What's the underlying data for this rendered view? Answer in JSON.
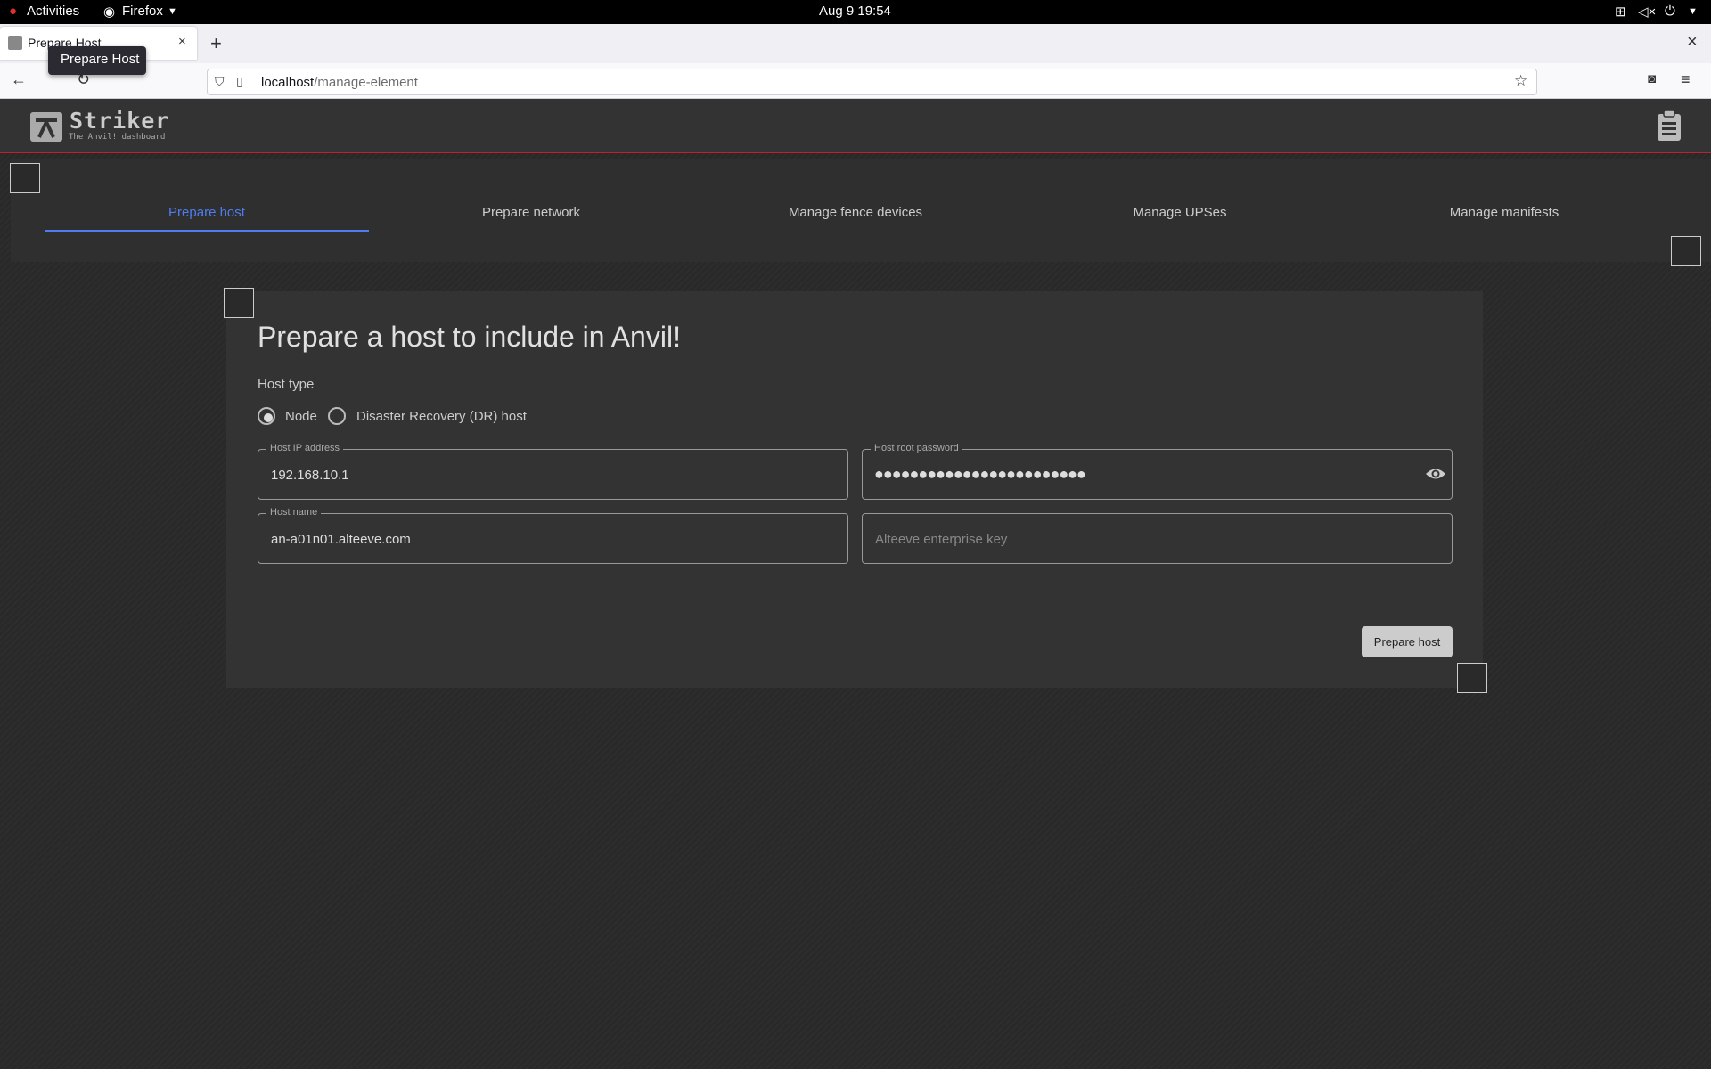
{
  "system_bar": {
    "activities": "Activities",
    "app": "Firefox",
    "clock": "Aug 9  19:54"
  },
  "browser": {
    "tab_title": "Prepare Host",
    "tooltip": "Prepare Host",
    "url_host": "localhost",
    "url_path": "/manage-element"
  },
  "app": {
    "name": "Striker",
    "subtitle": "The Anvil! dashboard"
  },
  "tabs": [
    {
      "label": "Prepare host",
      "active": true
    },
    {
      "label": "Prepare network",
      "active": false
    },
    {
      "label": "Manage fence devices",
      "active": false
    },
    {
      "label": "Manage UPSes",
      "active": false
    },
    {
      "label": "Manage manifests",
      "active": false
    }
  ],
  "form": {
    "title": "Prepare a host to include in Anvil!",
    "host_type_label": "Host type",
    "host_type_options": [
      {
        "label": "Node",
        "selected": true
      },
      {
        "label": "Disaster Recovery (DR) host",
        "selected": false
      }
    ],
    "ip_label": "Host IP address",
    "ip_value": "192.168.10.1",
    "password_label": "Host root password",
    "password_mask": "●●●●●●●●●●●●●●●●●●●●●●●●",
    "hostname_label": "Host name",
    "hostname_value": "an-a01n01.alteeve.com",
    "enterprise_key_placeholder": "Alteeve enterprise key",
    "submit_label": "Prepare host"
  },
  "colors": {
    "accent": "#4d7df0",
    "header_line": "#c0202f"
  }
}
